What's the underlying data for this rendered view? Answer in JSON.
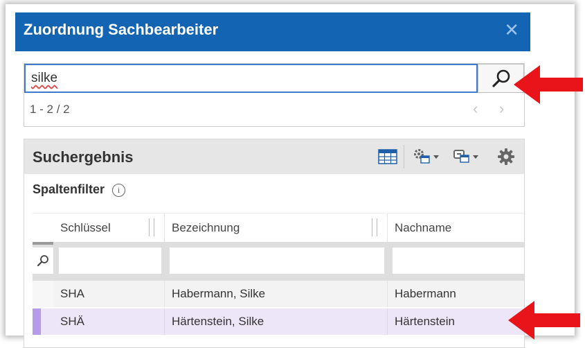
{
  "dialog": {
    "title": "Zuordnung Sachbearbeiter",
    "close_glyph": "✕"
  },
  "search": {
    "value": "silke",
    "pager_text": "1 - 2 / 2",
    "prev_glyph": "‹",
    "next_glyph": "›"
  },
  "results": {
    "title": "Suchergebnis",
    "filter_label": "Spaltenfilter",
    "info_glyph": "i",
    "columns": [
      "Schlüssel",
      "Bezeichnung",
      "Nachname"
    ],
    "rows": [
      {
        "key": "SHA",
        "name": "Habermann, Silke",
        "lastname": "Habermann",
        "selected": false
      },
      {
        "key": "SHÄ",
        "name": "Härtenstein, Silke",
        "lastname": "Härtenstein",
        "selected": true
      }
    ]
  },
  "icons": {
    "search": "search-icon",
    "grid": "table-view-icon",
    "settings_grid": "column-settings-icon",
    "export_grid": "export-icon",
    "gear": "gear-icon"
  },
  "colors": {
    "title_bar": "#1464b4",
    "accent_arrow": "#e8141a",
    "selected_row": "#ece6f8",
    "selected_marker": "#b59be8",
    "header_band": "#e6e6e6"
  }
}
